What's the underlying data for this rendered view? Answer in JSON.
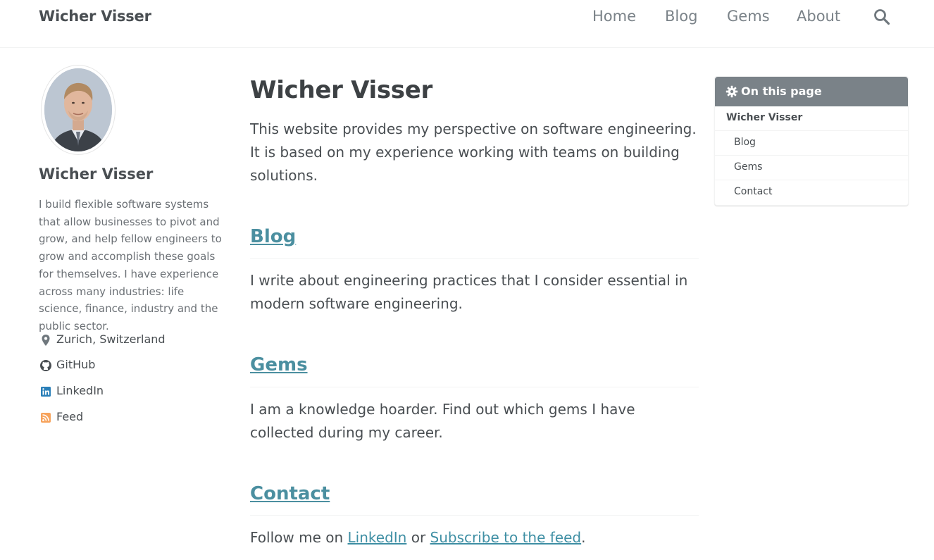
{
  "site": {
    "title": "Wicher Visser"
  },
  "nav": {
    "items": [
      {
        "label": "Home"
      },
      {
        "label": "Blog"
      },
      {
        "label": "Gems"
      },
      {
        "label": "About"
      }
    ],
    "search_icon": "search-icon"
  },
  "sidebar": {
    "author_name": "Wicher Visser",
    "bio": "I build flexible software systems that allow businesses to pivot and grow, and help fellow engineers to grow and accomplish these goals for themselves. I have experience across many industries: life science, finance, industry and the public sector.",
    "links": [
      {
        "label": "Zurich, Switzerland",
        "icon": "map-marker-icon"
      },
      {
        "label": "GitHub",
        "icon": "github-icon"
      },
      {
        "label": "LinkedIn",
        "icon": "linkedin-icon"
      },
      {
        "label": "Feed",
        "icon": "rss-icon"
      }
    ]
  },
  "main": {
    "title": "Wicher Visser",
    "intro": "This website provides my perspective on software engineering. It is based on my experience working with teams on building solutions.",
    "sections": [
      {
        "heading": "Blog",
        "text": "I write about engineering practices that I consider essential in modern software engineering."
      },
      {
        "heading": "Gems",
        "text": "I am a knowledge hoarder. Find out which gems I have collected during my career."
      },
      {
        "heading": "Contact",
        "text_before": "Follow me on ",
        "link1": "LinkedIn",
        "text_mid": " or ",
        "link2": "Subscribe to the feed",
        "text_after": "."
      }
    ]
  },
  "toc": {
    "title": "On this page",
    "items": [
      {
        "label": "Wicher Visser",
        "level": "top"
      },
      {
        "label": "Blog",
        "level": "sub"
      },
      {
        "label": "Gems",
        "level": "sub"
      },
      {
        "label": "Contact",
        "level": "sub"
      }
    ]
  },
  "colors": {
    "link": "#3f8fa4",
    "toc_header": "#7a8288",
    "linkedin": "#0077b5",
    "rss": "#fa9b39"
  }
}
